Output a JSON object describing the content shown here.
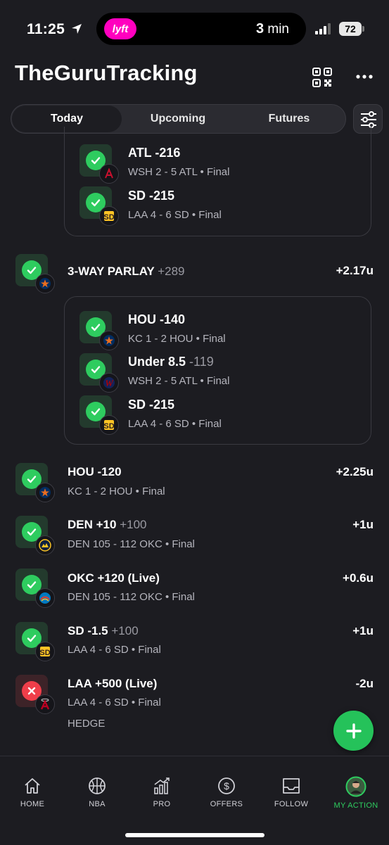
{
  "status_bar": {
    "time": "11:25",
    "island_app": "lyft",
    "island_eta_value": "3",
    "island_eta_unit": "min",
    "battery": "72"
  },
  "header": {
    "title": "TheGuruTracking"
  },
  "tabs": [
    {
      "label": "Today",
      "active": true
    },
    {
      "label": "Upcoming",
      "active": false
    },
    {
      "label": "Futures",
      "active": false
    }
  ],
  "bets": [
    {
      "legs": [
        {
          "title": "ATL -216",
          "odds": "",
          "sub": "WSH 2 - 5 ATL • Final",
          "logo": "braves-logo"
        },
        {
          "title": "SD -215",
          "odds": "",
          "sub": "LAA 4 - 6 SD • Final",
          "logo": "padres-logo"
        }
      ]
    },
    {
      "title": "3-WAY PARLAY",
      "odds": "+289",
      "result": "+2.17u",
      "status": "win",
      "logo": "astros-logo",
      "legs": [
        {
          "title": "HOU -140",
          "odds": "",
          "sub": "KC 1 - 2 HOU • Final",
          "logo": "astros-logo"
        },
        {
          "title": "Under 8.5",
          "odds": "-119",
          "sub": "WSH 2 - 5 ATL • Final",
          "logo": "nationals-logo"
        },
        {
          "title": "SD -215",
          "odds": "",
          "sub": "LAA 4 - 6 SD • Final",
          "logo": "padres-logo"
        }
      ]
    },
    {
      "title": "HOU -120",
      "odds": "",
      "sub": "KC 1 - 2 HOU • Final",
      "result": "+2.25u",
      "status": "win",
      "logo": "astros-logo"
    },
    {
      "title": "DEN +10",
      "odds": "+100",
      "sub": "DEN 105 - 112 OKC • Final",
      "result": "+1u",
      "status": "win",
      "logo": "nuggets-logo"
    },
    {
      "title": "OKC +120 (Live)",
      "odds": "",
      "sub": "DEN 105 - 112 OKC • Final",
      "result": "+0.6u",
      "status": "win",
      "logo": "thunder-logo"
    },
    {
      "title": "SD -1.5",
      "odds": "+100",
      "sub": "LAA 4 - 6 SD • Final",
      "result": "+1u",
      "status": "win",
      "logo": "padres-logo"
    },
    {
      "title": "LAA +500 (Live)",
      "odds": "",
      "sub": "LAA 4 - 6 SD • Final",
      "note": "HEDGE",
      "result": "-2u",
      "status": "loss",
      "logo": "angels-logo"
    }
  ],
  "bottom_nav": [
    {
      "label": "HOME",
      "icon": "home-icon",
      "active": false
    },
    {
      "label": "NBA",
      "icon": "basketball-icon",
      "active": false
    },
    {
      "label": "PRO",
      "icon": "chart-icon",
      "active": false
    },
    {
      "label": "OFFERS",
      "icon": "dollar-icon",
      "active": false
    },
    {
      "label": "FOLLOW",
      "icon": "inbox-icon",
      "active": false
    },
    {
      "label": "MY ACTION",
      "icon": "avatar",
      "active": true
    }
  ],
  "colors": {
    "win": "#2ecc5f",
    "loss": "#ef3e4a",
    "background": "#1c1c21",
    "accent": "#25c25a"
  }
}
